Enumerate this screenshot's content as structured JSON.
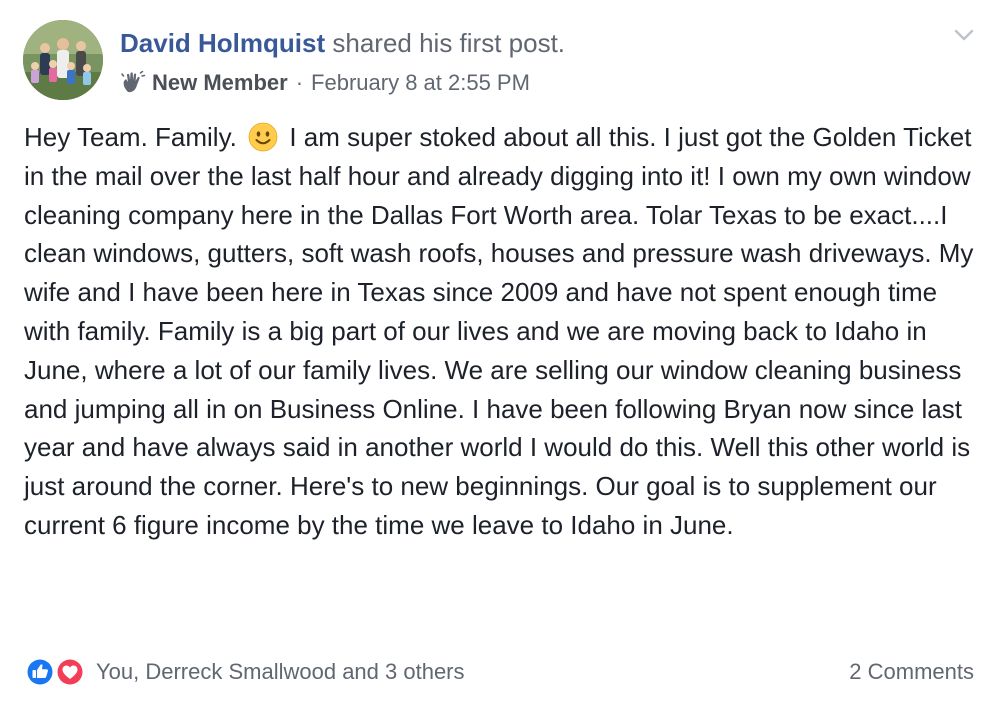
{
  "post": {
    "author": {
      "name": "David Holmquist",
      "action": "shared his first post."
    },
    "meta": {
      "badge_icon": "wave-hand-icon",
      "badge_label": "New Member",
      "separator": "·",
      "timestamp": "February 8 at 2:55 PM"
    },
    "body": {
      "text_before_emoji": "Hey Team. Family.",
      "emoji": "smiling-face-emoji",
      "text_after_emoji": "I am super stoked about all this. I just got the Golden Ticket in the mail over the last half hour and already digging into it! I own my own window cleaning company here in the Dallas Fort Worth area. Tolar Texas to be exact....I clean windows, gutters, soft wash roofs, houses and pressure wash driveways. My wife and I have been here in Texas since 2009 and have not spent enough time with family. Family is a big part of our lives and we are moving back to Idaho in June, where a lot of our family lives. We are selling our window cleaning business and jumping all in on Business Online. I have been following Bryan now since last year and have always said in another world I would do this. Well this other world is just around the corner. Here's to new beginnings. Our goal is to supplement our current 6 figure income by the time we leave to Idaho in June."
    },
    "footer": {
      "reactions": [
        "like-reaction-icon",
        "love-reaction-icon"
      ],
      "reactions_text": "You, Derreck Smallwood and 3 others",
      "comments_count": "2 Comments"
    },
    "colors": {
      "link_blue": "#385898",
      "secondary_text": "#616770",
      "body_text": "#1d2129",
      "like_blue": "#1877f2",
      "love_red": "#f33e58"
    }
  }
}
